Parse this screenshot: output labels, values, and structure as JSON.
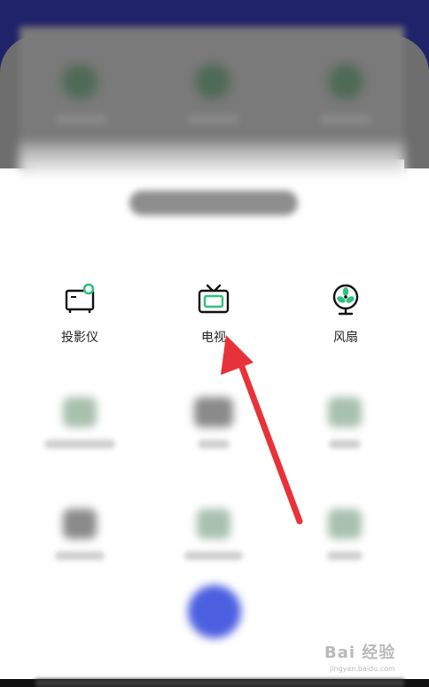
{
  "devices": [
    {
      "label": "投影仪",
      "icon": "projector-icon"
    },
    {
      "label": "电视",
      "icon": "tv-icon"
    },
    {
      "label": "风扇",
      "icon": "fan-icon"
    }
  ],
  "accent_color": "#2ec27e",
  "watermark": {
    "main": "Bai 经验",
    "sub": "jingyan.baidu.com"
  }
}
